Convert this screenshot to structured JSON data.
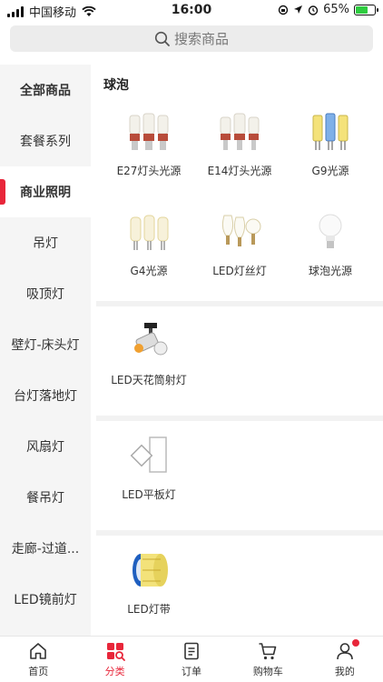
{
  "status_bar": {
    "carrier": "中国移动",
    "time": "16:00",
    "battery": "65%",
    "battery_level": 0.65
  },
  "search": {
    "placeholder": "搜索商品"
  },
  "sidebar": {
    "items": [
      {
        "label": "全部商品"
      },
      {
        "label": "套餐系列"
      },
      {
        "label": "商业照明"
      },
      {
        "label": "吊灯"
      },
      {
        "label": "吸顶灯"
      },
      {
        "label": "壁灯-床头灯"
      },
      {
        "label": "台灯落地灯"
      },
      {
        "label": "风扇灯"
      },
      {
        "label": "餐吊灯"
      },
      {
        "label": "走廊-过道..."
      },
      {
        "label": "LED镜前灯"
      }
    ],
    "active_index": 2
  },
  "main": {
    "sections": [
      {
        "title": "球泡",
        "products": [
          {
            "label": "E27灯头光源",
            "icon": "corn-bulb-red-icon"
          },
          {
            "label": "E14灯头光源",
            "icon": "corn-bulb-red-icon"
          },
          {
            "label": "G9光源",
            "icon": "g9-bulb-icon"
          },
          {
            "label": "G4光源",
            "icon": "g4-bulb-icon"
          },
          {
            "label": "LED灯丝灯",
            "icon": "filament-bulb-icon"
          },
          {
            "label": "球泡光源",
            "icon": "globe-bulb-icon"
          }
        ]
      },
      {
        "title": "",
        "products": [
          {
            "label": "LED天花筒射灯",
            "icon": "track-light-icon"
          }
        ]
      },
      {
        "title": "",
        "products": [
          {
            "label": "LED平板灯",
            "icon": "panel-light-icon"
          }
        ]
      },
      {
        "title": "",
        "products": [
          {
            "label": "LED灯带",
            "icon": "led-strip-icon"
          }
        ]
      }
    ]
  },
  "tabbar": {
    "items": [
      {
        "label": "首页",
        "icon": "home-icon"
      },
      {
        "label": "分类",
        "icon": "category-icon"
      },
      {
        "label": "订单",
        "icon": "order-icon"
      },
      {
        "label": "购物车",
        "icon": "cart-icon"
      },
      {
        "label": "我的",
        "icon": "user-icon"
      }
    ],
    "active_index": 1
  },
  "colors": {
    "accent": "#e8263a",
    "sidebar_bg": "#f5f5f5",
    "page_bg": "#f2f2f2"
  }
}
